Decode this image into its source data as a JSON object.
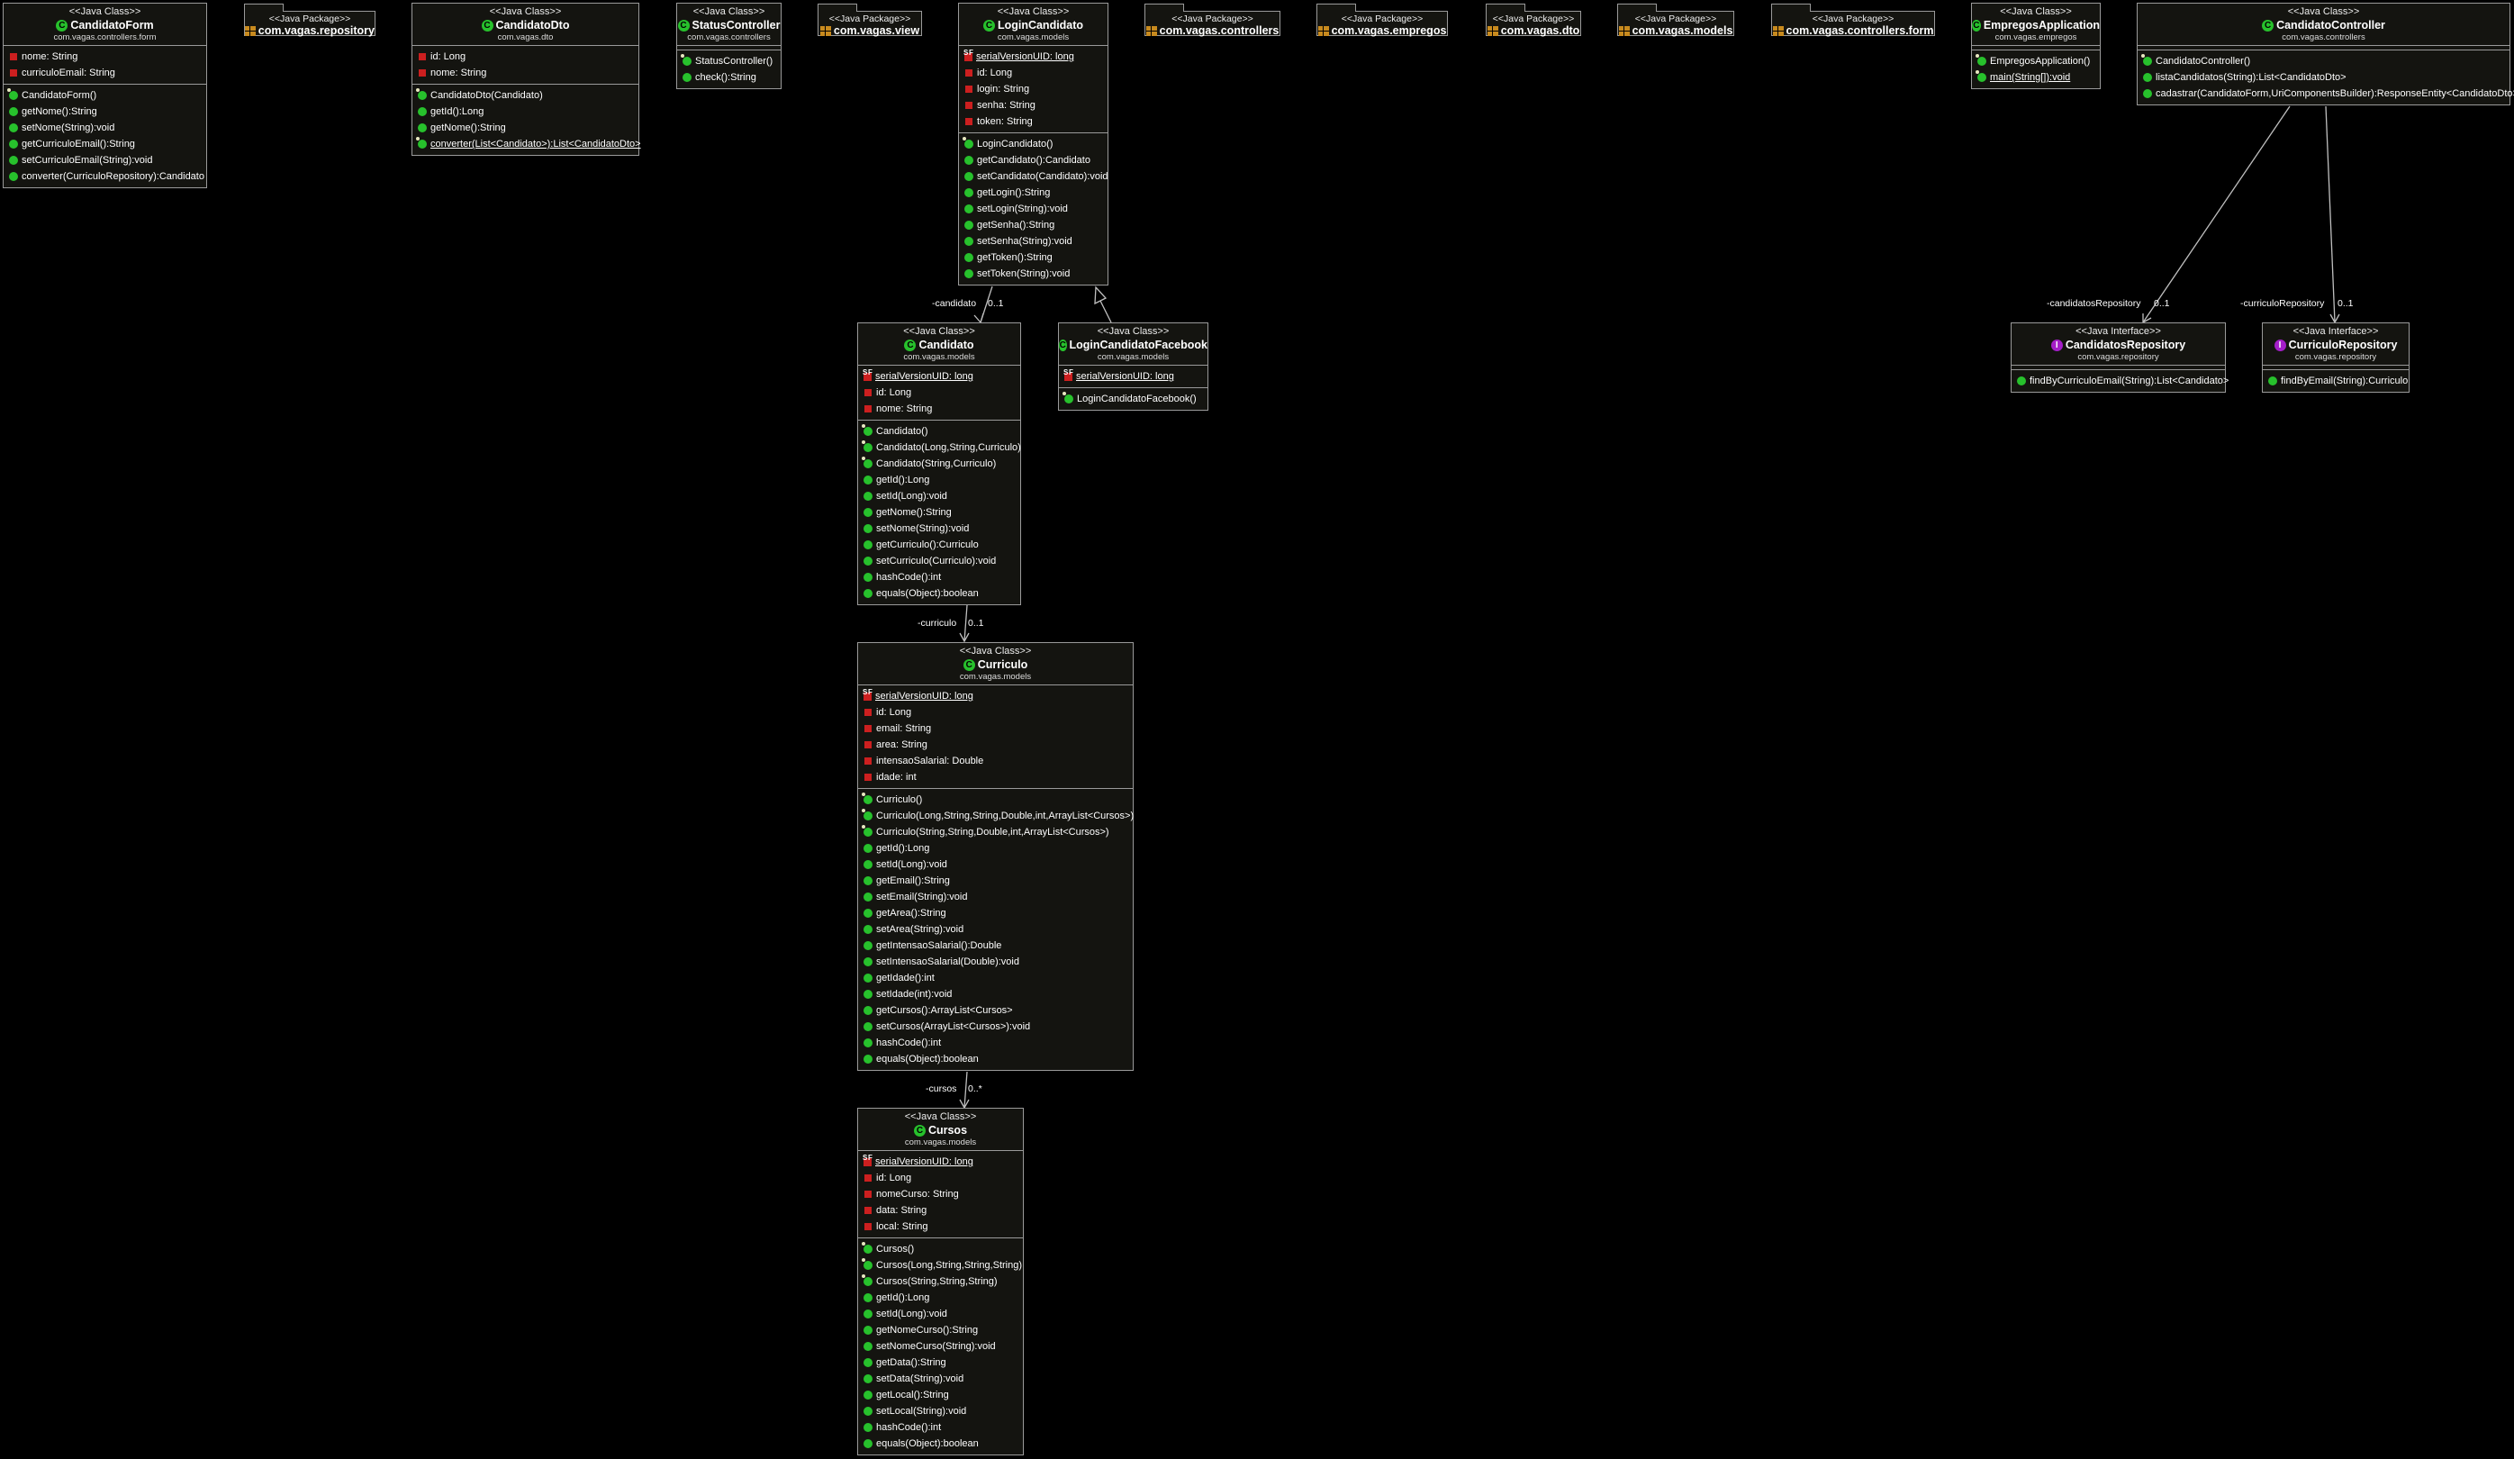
{
  "stereo": {
    "class": "<<Java Class>>",
    "package": "<<Java Package>>",
    "interface": "<<Java Interface>>"
  },
  "colors": {
    "background": "#000000",
    "box_fill": "#141410",
    "border": "#9a9a9a",
    "method_icon": "#27c12c",
    "field_icon": "#cc1f1f",
    "interface_icon": "#a41ec8",
    "package_icon": "#c88a1e"
  },
  "classes": {
    "candidatoForm": {
      "name": "CandidatoForm",
      "pkg": "com.vagas.controllers.form",
      "fields": [
        "nome: String",
        "curriculoEmail: String"
      ],
      "methods": [
        "CandidatoForm()",
        "getNome():String",
        "setNome(String):void",
        "getCurriculoEmail():String",
        "setCurriculoEmail(String):void",
        "converter(CurriculoRepository):Candidato"
      ]
    },
    "candidatoDto": {
      "name": "CandidatoDto",
      "pkg": "com.vagas.dto",
      "fields": [
        "id: Long",
        "nome: String"
      ],
      "methods": [
        "CandidatoDto(Candidato)",
        "getId():Long",
        "getNome():String",
        "converter(List<Candidato>):List<CandidatoDto>"
      ]
    },
    "statusController": {
      "name": "StatusController",
      "pkg": "com.vagas.controllers",
      "fields": [],
      "methods": [
        "StatusController()",
        "check():String"
      ]
    },
    "loginCandidato": {
      "name": "LoginCandidato",
      "pkg": "com.vagas.models",
      "fields": [
        "serialVersionUID: long",
        "id: Long",
        "login: String",
        "senha: String",
        "token: String"
      ],
      "methods": [
        "LoginCandidato()",
        "getCandidato():Candidato",
        "setCandidato(Candidato):void",
        "getLogin():String",
        "setLogin(String):void",
        "getSenha():String",
        "setSenha(String):void",
        "getToken():String",
        "setToken(String):void"
      ]
    },
    "empregosApplication": {
      "name": "EmpregosApplication",
      "pkg": "com.vagas.empregos",
      "fields": [],
      "methods": [
        "EmpregosApplication()",
        "main(String[]):void"
      ]
    },
    "candidatoController": {
      "name": "CandidatoController",
      "pkg": "com.vagas.controllers",
      "fields": [],
      "methods": [
        "CandidatoController()",
        "listaCandidatos(String):List<CandidatoDto>",
        "cadastrar(CandidatoForm,UriComponentsBuilder):ResponseEntity<CandidatoDto>"
      ]
    },
    "candidato": {
      "name": "Candidato",
      "pkg": "com.vagas.models",
      "fields": [
        "serialVersionUID: long",
        "id: Long",
        "nome: String"
      ],
      "methods": [
        "Candidato()",
        "Candidato(Long,String,Curriculo)",
        "Candidato(String,Curriculo)",
        "getId():Long",
        "setId(Long):void",
        "getNome():String",
        "setNome(String):void",
        "getCurriculo():Curriculo",
        "setCurriculo(Curriculo):void",
        "hashCode():int",
        "equals(Object):boolean"
      ]
    },
    "loginCandidatoFacebook": {
      "name": "LoginCandidatoFacebook",
      "pkg": "com.vagas.models",
      "fields": [
        "serialVersionUID: long"
      ],
      "methods": [
        "LoginCandidatoFacebook()"
      ]
    },
    "candidatosRepository": {
      "name": "CandidatosRepository",
      "pkg": "com.vagas.repository",
      "fields": [],
      "methods": [
        "findByCurriculoEmail(String):List<Candidato>"
      ]
    },
    "curriculoRepository": {
      "name": "CurriculoRepository",
      "pkg": "com.vagas.repository",
      "fields": [],
      "methods": [
        "findByEmail(String):Curriculo"
      ]
    },
    "curriculo": {
      "name": "Curriculo",
      "pkg": "com.vagas.models",
      "fields": [
        "serialVersionUID: long",
        "id: Long",
        "email: String",
        "area: String",
        "intensaoSalarial: Double",
        "idade: int"
      ],
      "methods": [
        "Curriculo()",
        "Curriculo(Long,String,String,Double,int,ArrayList<Cursos>)",
        "Curriculo(String,String,Double,int,ArrayList<Cursos>)",
        "getId():Long",
        "setId(Long):void",
        "getEmail():String",
        "setEmail(String):void",
        "getArea():String",
        "setArea(String):void",
        "getIntensaoSalarial():Double",
        "setIntensaoSalarial(Double):void",
        "getIdade():int",
        "setIdade(int):void",
        "getCursos():ArrayList<Cursos>",
        "setCursos(ArrayList<Cursos>):void",
        "hashCode():int",
        "equals(Object):boolean"
      ]
    },
    "cursos": {
      "name": "Cursos",
      "pkg": "com.vagas.models",
      "fields": [
        "serialVersionUID: long",
        "id: Long",
        "nomeCurso: String",
        "data: String",
        "local: String"
      ],
      "methods": [
        "Cursos()",
        "Cursos(Long,String,String,String)",
        "Cursos(String,String,String)",
        "getId():Long",
        "setId(Long):void",
        "getNomeCurso():String",
        "setNomeCurso(String):void",
        "getData():String",
        "setData(String):void",
        "getLocal():String",
        "setLocal(String):void",
        "hashCode():int",
        "equals(Object):boolean"
      ]
    }
  },
  "packages": {
    "repository": "com.vagas.repository",
    "view": "com.vagas.view",
    "controllers": "com.vagas.controllers",
    "empregos": "com.vagas.empregos",
    "dto": "com.vagas.dto",
    "models": "com.vagas.models",
    "controllersForm": "com.vagas.controllers.form"
  },
  "associations": {
    "candidato": {
      "role": "-candidato",
      "mult": "0..1"
    },
    "curriculo": {
      "role": "-curriculo",
      "mult": "0..1"
    },
    "cursos": {
      "role": "-cursos",
      "mult": "0..*"
    },
    "candidatosRepository": {
      "role": "-candidatosRepository",
      "mult": "0..1"
    },
    "curriculoRepository": {
      "role": "-curriculoRepository",
      "mult": "0..1"
    }
  }
}
